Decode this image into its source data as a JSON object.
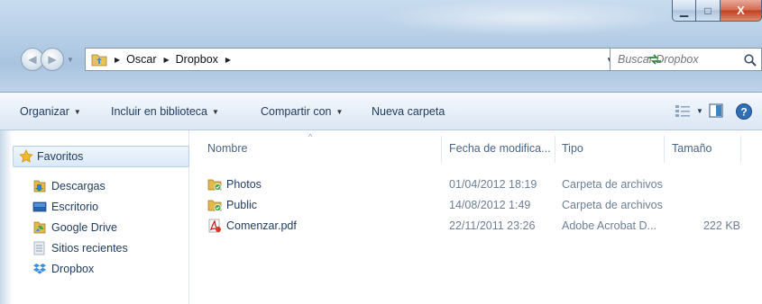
{
  "window": {
    "minimize_glyph": "▁",
    "maximize_glyph": "□",
    "close_glyph": "X"
  },
  "address": {
    "crumbs": [
      "Oscar",
      "Dropbox"
    ],
    "separator": "▶",
    "dropdown_glyph": "▼",
    "refresh_glyph": "↹"
  },
  "search": {
    "placeholder": "Buscar Dropbox"
  },
  "toolbar": {
    "organize": "Organizar",
    "include_library": "Incluir en biblioteca",
    "share_with": "Compartir con",
    "new_folder": "Nueva carpeta",
    "dropdown_glyph": "▼"
  },
  "nav": {
    "favorites": "Favoritos",
    "items": [
      "Descargas",
      "Escritorio",
      "Google Drive",
      "Sitios recientes",
      "Dropbox"
    ]
  },
  "columns": {
    "name": "Nombre",
    "date": "Fecha de modifica...",
    "type": "Tipo",
    "size": "Tamaño",
    "sort_glyph": "^"
  },
  "files": [
    {
      "name": "Photos",
      "date": "01/04/2012 18:19",
      "type": "Carpeta de archivos",
      "size": "",
      "icon": "dropbox-folder-icon"
    },
    {
      "name": "Public",
      "date": "14/08/2012 1:49",
      "type": "Carpeta de archivos",
      "size": "",
      "icon": "dropbox-folder-icon"
    },
    {
      "name": "Comenzar.pdf",
      "date": "22/11/2011 23:26",
      "type": "Adobe Acrobat D...",
      "size": "222 KB",
      "icon": "pdf-icon"
    }
  ],
  "colors": {
    "glass": "#b9d0e8",
    "text": "#1e3a5c",
    "close_red": "#c3401e"
  }
}
